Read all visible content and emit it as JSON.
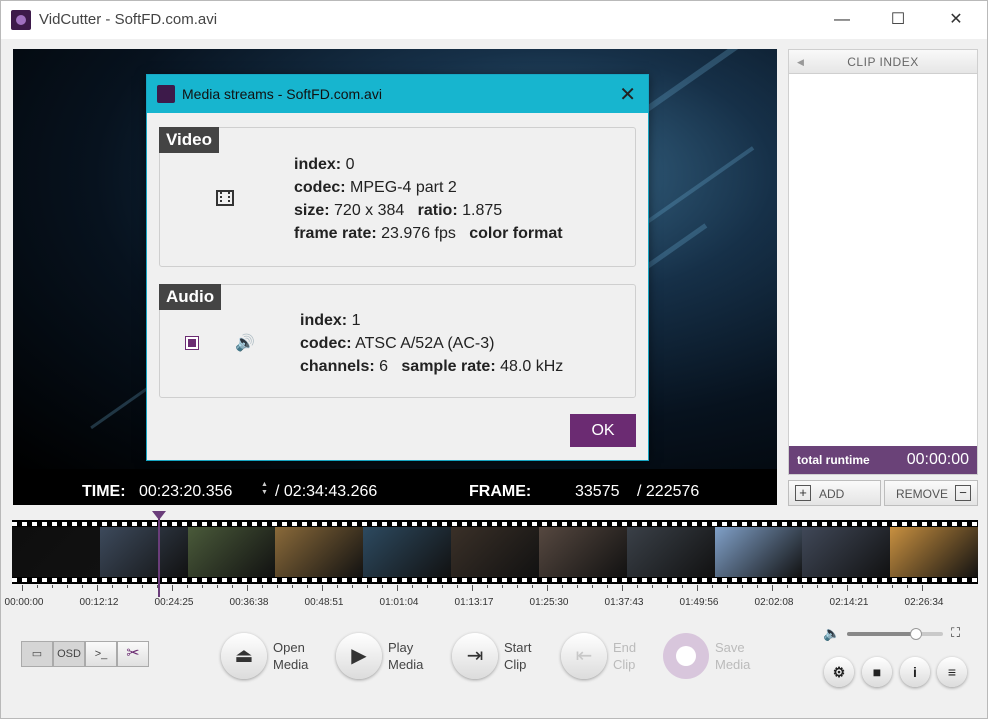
{
  "window": {
    "title": "VidCutter - SoftFD.com.avi",
    "minimize": "—",
    "maximize": "☐",
    "close": "✕"
  },
  "player": {
    "time_label": "TIME:",
    "time_value": "00:23:20.356",
    "duration": "/ 02:34:43.266",
    "frame_label": "FRAME:",
    "frame_value": "33575",
    "frame_total": "/ 222576"
  },
  "clip_index": {
    "header": "CLIP INDEX",
    "runtime_label": "total runtime",
    "runtime_value": "00:00:00",
    "add_label": "ADD",
    "remove_label": "REMOVE"
  },
  "timeline": {
    "ticks": [
      "00:00:00",
      "00:12:12",
      "00:24:25",
      "00:36:38",
      "00:48:51",
      "01:01:04",
      "01:13:17",
      "01:25:30",
      "01:37:43",
      "01:49:56",
      "02:02:08",
      "02:14:21",
      "02:26:34"
    ],
    "playhead_fraction": 0.151,
    "thumb_colors": [
      "#0e0e0e",
      "#3d4a5c",
      "#4a5a3a",
      "#8a6a3a",
      "#2d4a60",
      "#3a3028",
      "#564840",
      "#3a4048",
      "#80a0c8",
      "#404858",
      "#c89040"
    ]
  },
  "toolbar": {
    "thumbs_toggle": "▭",
    "osd_toggle": "OSD",
    "console_toggle": ">_",
    "cut_icon": "✂",
    "open_label_1": "Open",
    "open_label_2": "Media",
    "play_label_1": "Play",
    "play_label_2": "Media",
    "start_label_1": "Start",
    "start_label_2": "Clip",
    "end_label_1": "End",
    "end_label_2": "Clip",
    "save_label_1": "Save",
    "save_label_2": "Media",
    "volume_level": 0.72
  },
  "dialog": {
    "title": "Media streams - SoftFD.com.avi",
    "close": "✕",
    "video": {
      "header": "Video",
      "index_label": "index:",
      "index_value": "0",
      "codec_label": "codec:",
      "codec_value": "MPEG-4 part 2",
      "size_label": "size:",
      "size_value": "720 x 384",
      "ratio_label": "ratio:",
      "ratio_value": "1.875",
      "framerate_label": "frame rate:",
      "framerate_value": "23.976 fps",
      "colorformat_label": "color format"
    },
    "audio": {
      "header": "Audio",
      "index_label": "index:",
      "index_value": "1",
      "codec_label": "codec:",
      "codec_value": "ATSC A/52A (AC-3)",
      "channels_label": "channels:",
      "channels_value": "6",
      "samplerate_label": "sample rate:",
      "samplerate_value": "48.0 kHz"
    },
    "ok_label": "OK"
  }
}
